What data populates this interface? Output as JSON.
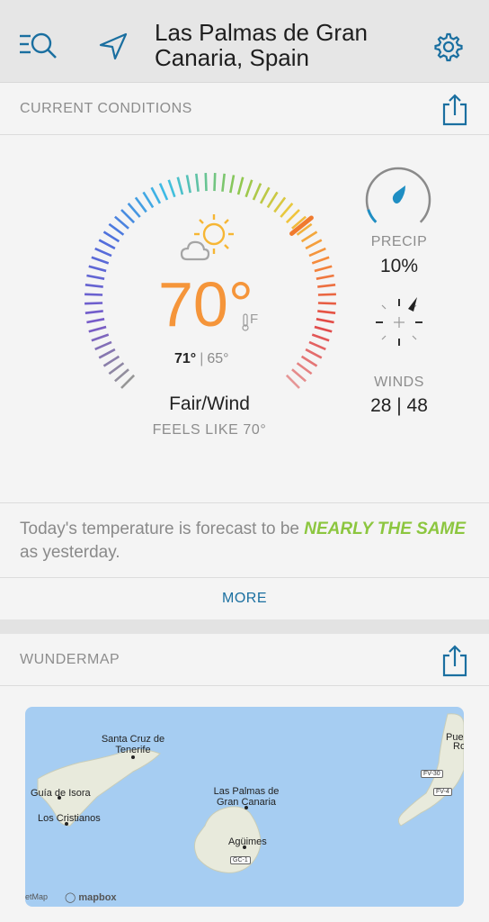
{
  "header": {
    "location": "Las Palmas de Gran Canaria, Spain",
    "search_icon": "search-list-icon",
    "nav_icon": "location-arrow-icon",
    "settings_icon": "gear-icon"
  },
  "current_conditions": {
    "section_title": "CURRENT CONDITIONS",
    "share_icon": "share-icon",
    "temperature": "70°",
    "unit": "F",
    "high": "71°",
    "low": "65°",
    "condition": "Fair/Wind",
    "feels_like": "FEELS LIKE 70°",
    "condition_icon": "sun-cloud-icon",
    "precip_label": "PRECIP",
    "precip_value": "10%",
    "precip_fraction": 0.1,
    "winds_label": "WINDS",
    "winds_value": "28 | 48"
  },
  "forecast": {
    "prefix": "Today's temperature is forecast to be ",
    "emphasis": "NEARLY THE SAME",
    "suffix": " as yesterday."
  },
  "more_label": "MORE",
  "wundermap": {
    "section_title": "WUNDERMAP",
    "share_icon": "share-icon",
    "labels": {
      "santa_cruz": "Santa Cruz de Tenerife",
      "guia": "Guía de Isora",
      "cristianos": "Los Cristianos",
      "las_palmas": "Las Palmas de Gran Canaria",
      "aguimes": "Agüimes",
      "pue": "Pue",
      "ro": "Ro"
    },
    "roads": {
      "gc1": "GC-1",
      "fv30": "FV-30",
      "fv4": "FV-4"
    },
    "attribution": "etMap",
    "mapbox": "mapbox"
  },
  "colors": {
    "temp": "#f5953a",
    "accent_blue": "#1a6fa0",
    "emphasis_green": "#8cc63f"
  }
}
